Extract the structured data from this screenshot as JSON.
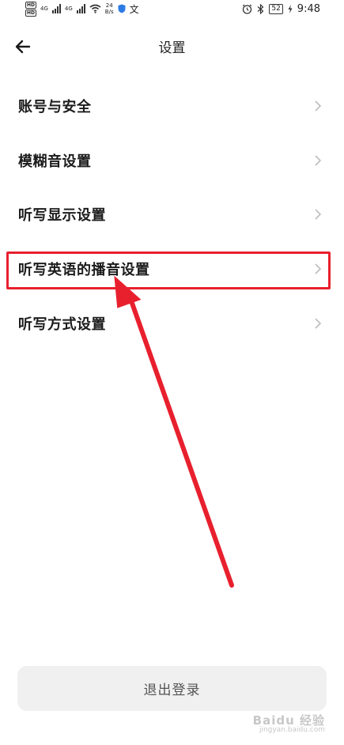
{
  "status_bar": {
    "hd_badge": "HD",
    "net_type": "4G",
    "net_speed_value": "24",
    "net_speed_unit": "B/s",
    "text_icon": "文",
    "battery": "52",
    "time": "9:48",
    "icons": [
      "signal-icon",
      "wifi-icon",
      "shield-icon",
      "alarm-icon",
      "bluetooth-icon",
      "charging-icon"
    ]
  },
  "header": {
    "back_icon": "arrow-left-icon",
    "title": "设置"
  },
  "menu": {
    "items": [
      {
        "label": "账号与安全"
      },
      {
        "label": "模糊音设置"
      },
      {
        "label": "听写显示设置"
      },
      {
        "label": "听写英语的播音设置"
      },
      {
        "label": "听写方式设置"
      }
    ],
    "chevron_icon": "chevron-right-icon"
  },
  "annotation": {
    "highlight_color": "#e8202e",
    "highlighted_item": "听写英语的播音设置"
  },
  "logout": {
    "label": "退出登录"
  },
  "watermark": {
    "text": "Baidu 经验",
    "sub": "jingyan.baidu.com"
  }
}
